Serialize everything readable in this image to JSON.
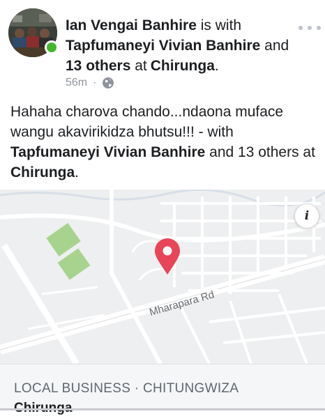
{
  "post": {
    "author": "Ian Vengai Banhire",
    "is_with_text": "is with",
    "tagged_person": "Tapfumaneyi Vivian Banhire",
    "and_text": "and",
    "others": "13 others",
    "at_text": "at",
    "location": "Chirunga",
    "end_punct": ".",
    "time": "56m",
    "separator": "·",
    "privacy_icon": "globe-icon",
    "body_text": "Hahaha charova chando...ndaona muface wangu akavirikidza bhutsu!!! - with",
    "body_tagged": "Tapfumaneyi Vivian Banhire",
    "body_and": "and 13 others at",
    "body_location": "Chirunga",
    "body_end": "."
  },
  "map": {
    "road_label": "Mharapara Rd",
    "info_label": "i",
    "pin_color": "#e8445a"
  },
  "place": {
    "category": "LOCAL BUSINESS · CHITUNGWIZA",
    "name": "Chirunga"
  },
  "colors": {
    "online": "#42b72a",
    "meta_gray": "#90949c",
    "park_green": "#a8d38f"
  }
}
